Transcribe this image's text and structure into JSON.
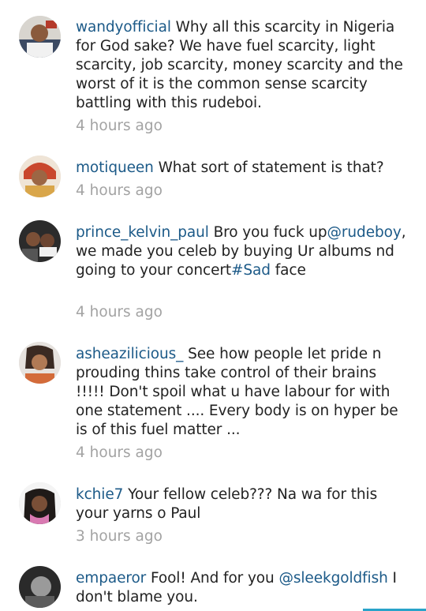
{
  "comments": [
    {
      "username": "wandyofficial",
      "text": "Why all this scarcity in Nigeria for God sake?  We have fuel scarcity, light scarcity, job scarcity, money scarcity and the worst of it is the common sense scarcity battling with this rudeboi.",
      "time": "4 hours ago"
    },
    {
      "username": "motiqueen",
      "text": "What sort of statement is that?",
      "time": "4 hours ago"
    },
    {
      "username": "prince_kelvin_paul",
      "text_a": "Bro you fuck up",
      "mention": "@rudeboy",
      "text_b": ", we made you celeb by buying Ur albums nd going to your concert",
      "hashtag": "#Sad",
      "text_c": " face",
      "time": "4 hours ago"
    },
    {
      "username": "asheazilicious_",
      "text": "See how people let pride n prouding thins take control of their brains !!!!! Don't spoil what u have labour for with one statement .... Every body is on hyper be is of this fuel matter ...",
      "time": "4 hours ago"
    },
    {
      "username": "kchie7",
      "text": "Your fellow celeb??? Na wa for this your yarns o Paul",
      "time": "3 hours ago"
    },
    {
      "username": "empaeror",
      "text_a": "Fool! And for you ",
      "mention": "@sleekgoldfish",
      "text_b": " I don't blame you."
    }
  ],
  "colors": {
    "username": "#1c5a88",
    "timestamp": "#a3a3a3",
    "accent": "#29a3c9"
  }
}
